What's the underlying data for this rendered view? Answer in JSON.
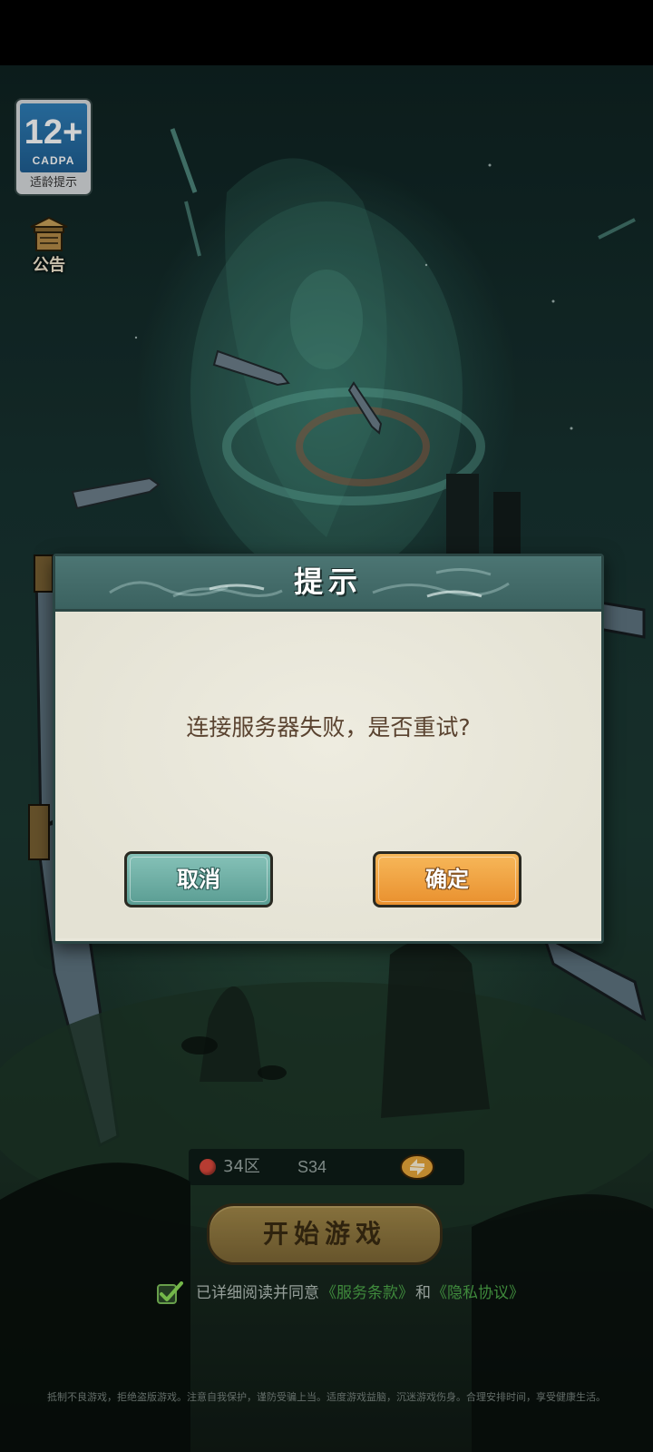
{
  "age_rating": {
    "age": "12+",
    "org": "CADPA",
    "tip": "适龄提示"
  },
  "notice": {
    "label": "公告"
  },
  "dialog": {
    "title": "提示",
    "message": "连接服务器失败，是否重试?",
    "cancel_label": "取消",
    "confirm_label": "确定"
  },
  "server": {
    "zone": "34区",
    "name": "S34",
    "status_color": "#e04a3d"
  },
  "start_button": {
    "label": "开始游戏"
  },
  "agreement": {
    "checked": true,
    "text": "已详细阅读并同意",
    "service_link": "《服务条款》",
    "and_text": "和",
    "privacy_link": "《隐私协议》"
  },
  "advisory": "抵制不良游戏，拒绝盗版游戏。注意自我保护，谨防受骗上当。适度游戏益脑，沉迷游戏伤身。合理安排时间，享受健康生活。",
  "icons": {
    "switch": "switch-arrows-icon",
    "check": "checkmark-icon",
    "notice": "pavilion-icon"
  }
}
